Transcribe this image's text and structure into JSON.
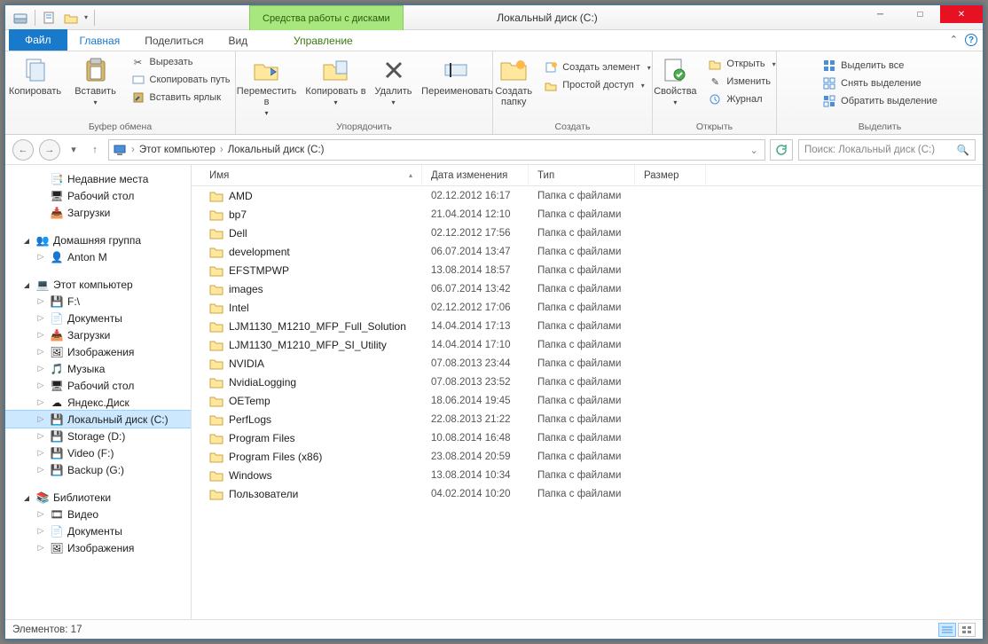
{
  "window": {
    "title": "Локальный диск (C:)",
    "context_tab": "Средства работы с дисками"
  },
  "tabs": {
    "file": "Файл",
    "home": "Главная",
    "share": "Поделиться",
    "view": "Вид",
    "manage": "Управление"
  },
  "ribbon": {
    "clipboard": {
      "label": "Буфер обмена",
      "copy": "Копировать",
      "paste": "Вставить",
      "cut": "Вырезать",
      "copy_path": "Скопировать путь",
      "paste_shortcut": "Вставить ярлык"
    },
    "organize": {
      "label": "Упорядочить",
      "move_to": "Переместить в",
      "copy_to": "Копировать в",
      "delete": "Удалить",
      "rename": "Переименовать"
    },
    "create": {
      "label": "Создать",
      "new_folder": "Создать папку",
      "new_item": "Создать элемент",
      "easy_access": "Простой доступ"
    },
    "open": {
      "label": "Открыть",
      "properties": "Свойства",
      "open": "Открыть",
      "edit": "Изменить",
      "history": "Журнал"
    },
    "select": {
      "label": "Выделить",
      "select_all": "Выделить все",
      "select_none": "Снять выделение",
      "invert": "Обратить выделение"
    }
  },
  "breadcrumbs": [
    "Этот компьютер",
    "Локальный диск (C:)"
  ],
  "search_placeholder": "Поиск: Локальный диск (C:)",
  "columns": {
    "name": "Имя",
    "date": "Дата изменения",
    "type": "Тип",
    "size": "Размер"
  },
  "folder_type": "Папка с файлами",
  "files": [
    {
      "name": "AMD",
      "date": "02.12.2012 16:17"
    },
    {
      "name": "bp7",
      "date": "21.04.2014 12:10"
    },
    {
      "name": "Dell",
      "date": "02.12.2012 17:56"
    },
    {
      "name": "development",
      "date": "06.07.2014 13:47"
    },
    {
      "name": "EFSTMPWP",
      "date": "13.08.2014 18:57"
    },
    {
      "name": "images",
      "date": "06.07.2014 13:42"
    },
    {
      "name": "Intel",
      "date": "02.12.2012 17:06"
    },
    {
      "name": "LJM1130_M1210_MFP_Full_Solution",
      "date": "14.04.2014 17:13"
    },
    {
      "name": "LJM1130_M1210_MFP_SI_Utility",
      "date": "14.04.2014 17:10"
    },
    {
      "name": "NVIDIA",
      "date": "07.08.2013 23:44"
    },
    {
      "name": "NvidiaLogging",
      "date": "07.08.2013 23:52"
    },
    {
      "name": "OETemp",
      "date": "18.06.2014 19:45"
    },
    {
      "name": "PerfLogs",
      "date": "22.08.2013 21:22"
    },
    {
      "name": "Program Files",
      "date": "10.08.2014 16:48"
    },
    {
      "name": "Program Files (x86)",
      "date": "23.08.2014 20:59"
    },
    {
      "name": "Windows",
      "date": "13.08.2014 10:34"
    },
    {
      "name": "Пользователи",
      "date": "04.02.2014 10:20"
    }
  ],
  "tree": {
    "recent": "Недавние места",
    "desktop": "Рабочий стол",
    "downloads": "Загрузки",
    "homegroup": "Домашняя группа",
    "user": "Anton M",
    "this_pc": "Этот компьютер",
    "drive_f": "F:\\",
    "documents": "Документы",
    "downloads2": "Загрузки",
    "pictures": "Изображения",
    "music": "Музыка",
    "desktop2": "Рабочий стол",
    "yadisk": "Яндекс.Диск",
    "drive_c": "Локальный диск (C:)",
    "storage_d": "Storage (D:)",
    "video_f": "Video (F:)",
    "backup_g": "Backup (G:)",
    "libraries": "Библиотеки",
    "lib_video": "Видео",
    "lib_docs": "Документы",
    "lib_pics": "Изображения"
  },
  "status": {
    "items": "Элементов: 17"
  }
}
